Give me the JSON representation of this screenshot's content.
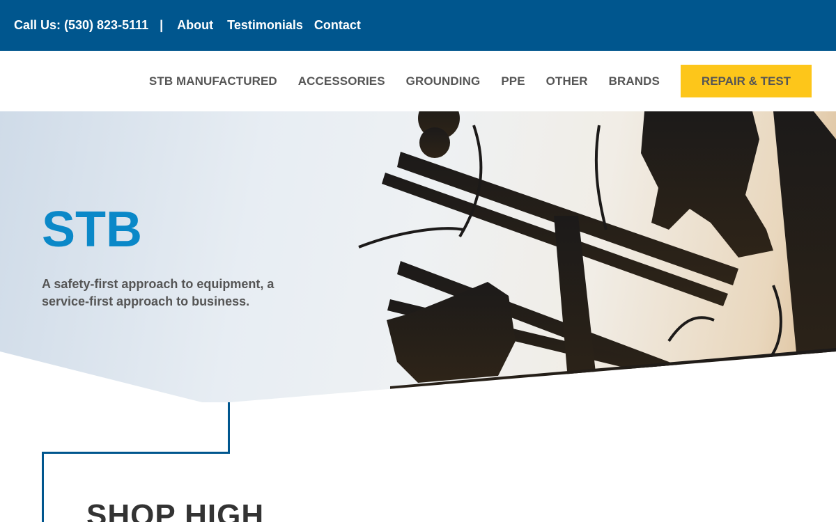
{
  "topbar": {
    "phone": "Call Us: (530) 823-5111",
    "separator": "|",
    "links": {
      "about": "About",
      "testimonials": "Testimonials",
      "contact": "Contact"
    }
  },
  "nav": {
    "items": [
      {
        "label": "STB MANUFACTURED"
      },
      {
        "label": "ACCESSORIES"
      },
      {
        "label": "GROUNDING"
      },
      {
        "label": "PPE"
      },
      {
        "label": "OTHER"
      },
      {
        "label": "BRANDS"
      }
    ],
    "cta_label": "REPAIR & TEST"
  },
  "hero": {
    "title": "STB",
    "subtitle": "A safety-first approach to equipment, a service-first approach to business."
  },
  "section": {
    "heading": "SHOP HIGH"
  },
  "colors": {
    "brand_blue": "#00568e",
    "title_blue": "#0a88c8",
    "cta_yellow": "#fdc61a"
  }
}
